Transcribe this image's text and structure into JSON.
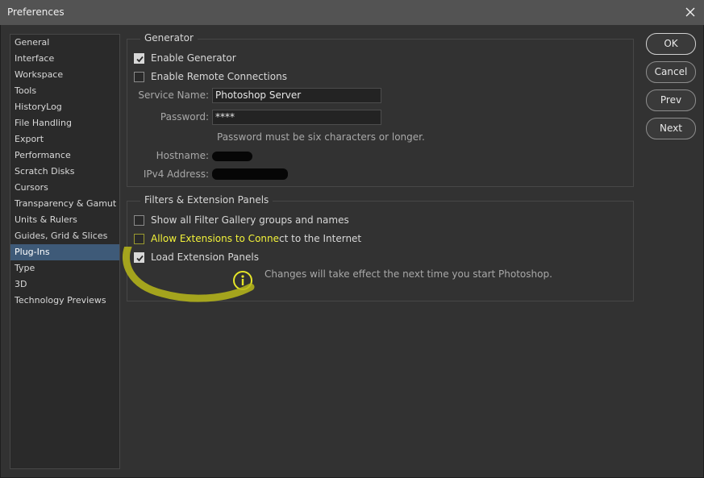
{
  "window": {
    "title": "Preferences",
    "close_icon": "close-icon"
  },
  "sidebar": {
    "items": [
      {
        "label": "General"
      },
      {
        "label": "Interface"
      },
      {
        "label": "Workspace"
      },
      {
        "label": "Tools"
      },
      {
        "label": "HistoryLog"
      },
      {
        "label": "File Handling"
      },
      {
        "label": "Export"
      },
      {
        "label": "Performance"
      },
      {
        "label": "Scratch Disks"
      },
      {
        "label": "Cursors"
      },
      {
        "label": "Transparency & Gamut"
      },
      {
        "label": "Units & Rulers"
      },
      {
        "label": "Guides, Grid & Slices"
      },
      {
        "label": "Plug-Ins",
        "selected": true
      },
      {
        "label": "Type"
      },
      {
        "label": "3D"
      },
      {
        "label": "Technology Previews"
      }
    ]
  },
  "generator": {
    "title": "Generator",
    "enable_generator": {
      "label": "Enable Generator",
      "checked": true
    },
    "enable_remote": {
      "label": "Enable Remote Connections",
      "checked": false
    },
    "service_name": {
      "label": "Service Name:",
      "value": "Photoshop Server"
    },
    "password": {
      "label": "Password:",
      "value": "****"
    },
    "password_hint": "Password must be six characters or longer.",
    "hostname": {
      "label": "Hostname:"
    },
    "ipv4": {
      "label": "IPv4 Address:"
    }
  },
  "extensions": {
    "title": "Filters & Extension Panels",
    "show_filter_gallery": {
      "label": "Show all Filter Gallery groups and names",
      "checked": false
    },
    "allow_extensions": {
      "label_highlight": "Allow Extensions to Conne",
      "label_rest": "ct to the Internet",
      "checked": false
    },
    "load_panels": {
      "label": "Load Extension Panels",
      "checked": true
    },
    "note": "Changes will take effect the next time you start Photoshop."
  },
  "buttons": {
    "ok": "OK",
    "cancel": "Cancel",
    "prev": "Prev",
    "next": "Next"
  },
  "colors": {
    "selection": "#3e5a78",
    "annotation": "#e3e31a",
    "background": "#323232"
  }
}
